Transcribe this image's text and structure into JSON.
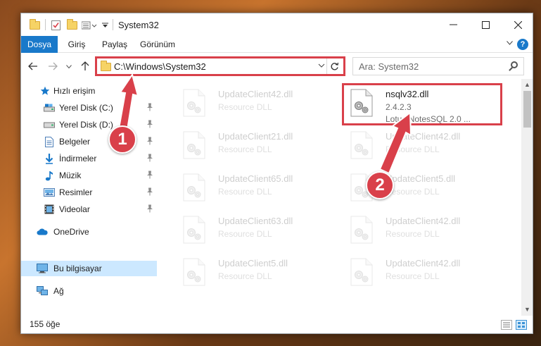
{
  "window": {
    "title": "System32"
  },
  "ribbon": {
    "tabs": [
      {
        "label": "Dosya",
        "active": true
      },
      {
        "label": "Giriş"
      },
      {
        "label": "Paylaş"
      },
      {
        "label": "Görünüm"
      }
    ],
    "help": "?"
  },
  "address": {
    "path": "C:\\Windows\\System32",
    "search_placeholder": "Ara: System32"
  },
  "sidebar": {
    "items": [
      {
        "label": "Hızlı erişim",
        "icon": "star-icon",
        "pinned": false
      },
      {
        "label": "Yerel Disk (C:)",
        "icon": "drive-icon",
        "pinned": true
      },
      {
        "label": "Yerel Disk (D:)",
        "icon": "drive-icon",
        "pinned": true
      },
      {
        "label": "Belgeler",
        "icon": "document-icon",
        "pinned": true
      },
      {
        "label": "İndirmeler",
        "icon": "download-icon",
        "pinned": true
      },
      {
        "label": "Müzik",
        "icon": "music-icon",
        "pinned": true
      },
      {
        "label": "Resimler",
        "icon": "picture-icon",
        "pinned": true
      },
      {
        "label": "Videolar",
        "icon": "video-icon",
        "pinned": true
      },
      {
        "label": "OneDrive",
        "icon": "cloud-icon",
        "pinned": false
      },
      {
        "label": "Bu bilgisayar",
        "icon": "computer-icon",
        "pinned": false,
        "selected": true
      },
      {
        "label": "Ağ",
        "icon": "network-icon",
        "pinned": false
      }
    ]
  },
  "files": {
    "left": [
      {
        "name": "UpdateClient42.dll",
        "type": "Resource DLL"
      },
      {
        "name": "UpdateClient21.dll",
        "type": "Resource DLL"
      },
      {
        "name": "UpdateClient65.dll",
        "type": "Resource DLL"
      },
      {
        "name": "UpdateClient63.dll",
        "type": "Resource DLL"
      },
      {
        "name": "UpdateClient5.dll",
        "type": "Resource DLL"
      }
    ],
    "right": [
      {
        "name": "nsqlv32.dll",
        "type": "2.4.2.3",
        "desc": "Lotus NotesSQL 2.0 ...",
        "highlight": true
      },
      {
        "name": "UpdateClient42.dll",
        "type": "Resource DLL"
      },
      {
        "name": "UpdateClient5.dll",
        "type": "Resource DLL"
      },
      {
        "name": "UpdateClient42.dll",
        "type": "Resource DLL"
      },
      {
        "name": "UpdateClient42.dll",
        "type": "Resource DLL"
      }
    ]
  },
  "status": {
    "count": "155 öğe"
  },
  "annotations": {
    "step1": "1",
    "step2": "2",
    "color": "#d9404a"
  },
  "icons": {
    "pin": "📌",
    "gear": "gear-icon"
  }
}
